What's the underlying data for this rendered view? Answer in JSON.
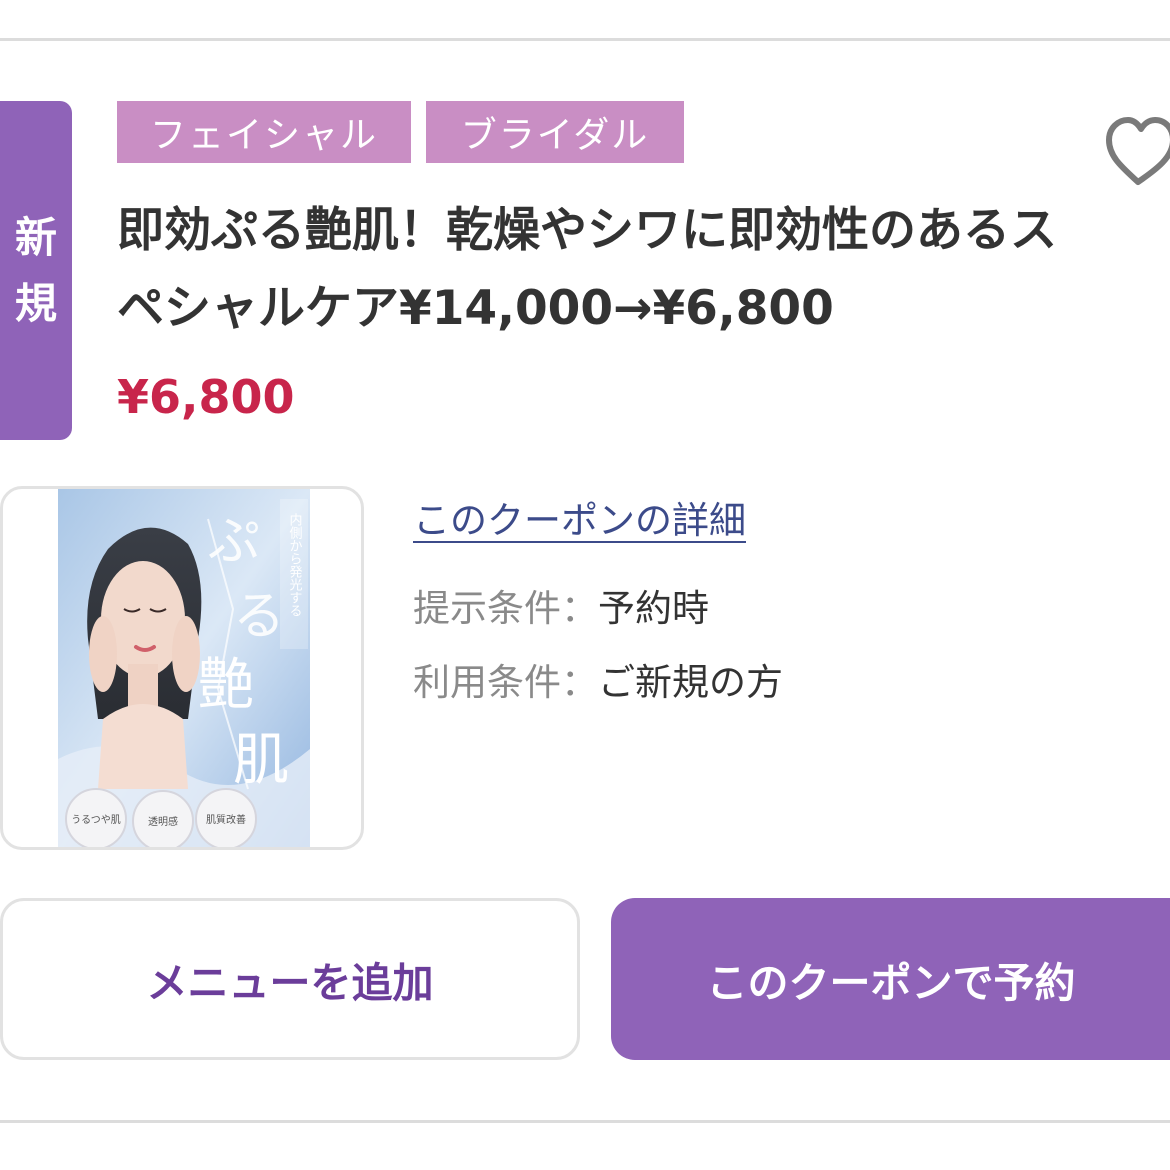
{
  "badge": {
    "line1": "新",
    "line2": "規"
  },
  "tags": [
    "フェイシャル",
    "ブライダル"
  ],
  "favorite_icon": "heart-outline-icon",
  "coupon": {
    "title": "即効ぷる艶肌！乾燥やシワに即効性のあるスペシャルケア¥14,000→¥6,800",
    "price": "¥6,800",
    "detail_link": "このクーポンの詳細",
    "conditions": [
      {
        "label": "提示条件",
        "sep": "：",
        "value": "予約時"
      },
      {
        "label": "利用条件",
        "sep": "：",
        "value": "ご新規の方"
      }
    ]
  },
  "image": {
    "vertical_caption": "内側から発光する",
    "headline": "ぷる艶肌",
    "bubbles": [
      "うるつや肌",
      "透明感",
      "肌質改善"
    ]
  },
  "buttons": {
    "add_menu": "メニューを追加",
    "reserve": "このクーポンで予約"
  },
  "colors": {
    "accent": "#8f63b8",
    "tag": "#c98ec4",
    "price": "#c8254b",
    "link": "#3c4b8a"
  }
}
